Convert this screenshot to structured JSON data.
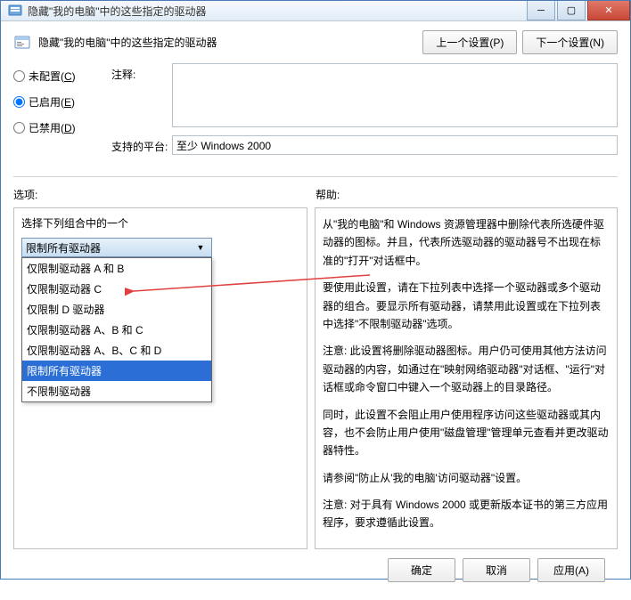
{
  "titlebar": {
    "text": "隐藏\"我的电脑\"中的这些指定的驱动器"
  },
  "header": {
    "title": "隐藏\"我的电脑\"中的这些指定的驱动器",
    "prev_button": "上一个设置(P)",
    "next_button": "下一个设置(N)"
  },
  "radios": {
    "not_configured": "未配置(C)",
    "enabled": "已启用(E)",
    "disabled": "已禁用(D)",
    "selected": "enabled"
  },
  "fields": {
    "note_label": "注释:",
    "note_value": "",
    "platform_label": "支持的平台:",
    "platform_value": "至少 Windows 2000"
  },
  "sections": {
    "options_label": "选项:",
    "help_label": "帮助:"
  },
  "options": {
    "prompt": "选择下列组合中的一个",
    "selected_index": 6,
    "selected_label": "限制所有驱动器",
    "items": [
      "仅限制驱动器 A 和 B",
      "仅限制驱动器 C",
      "仅限制 D 驱动器",
      "仅限制驱动器 A、B 和 C",
      "仅限制驱动器 A、B、C 和 D",
      "限制所有驱动器",
      "不限制驱动器"
    ]
  },
  "help": {
    "p1": "从\"我的电脑\"和 Windows 资源管理器中删除代表所选硬件驱动器的图标。并且，代表所选驱动器的驱动器号不出现在标准的\"打开\"对话框中。",
    "p2": "要使用此设置，请在下拉列表中选择一个驱动器或多个驱动器的组合。要显示所有驱动器，请禁用此设置或在下拉列表中选择\"不限制驱动器\"选项。",
    "p3": "注意: 此设置将删除驱动器图标。用户仍可使用其他方法访问驱动器的内容，如通过在\"映射网络驱动器\"对话框、\"运行\"对话框或命令窗口中键入一个驱动器上的目录路径。",
    "p4": "同时，此设置不会阻止用户使用程序访问这些驱动器或其内容，也不会防止用户使用\"磁盘管理\"管理单元查看并更改驱动器特性。",
    "p5": "请参阅\"防止从'我的电脑'访问驱动器\"设置。",
    "p6": "注意: 对于具有 Windows 2000 或更新版本证书的第三方应用程序，要求遵循此设置。"
  },
  "footer": {
    "ok": "确定",
    "cancel": "取消",
    "apply": "应用(A)"
  }
}
